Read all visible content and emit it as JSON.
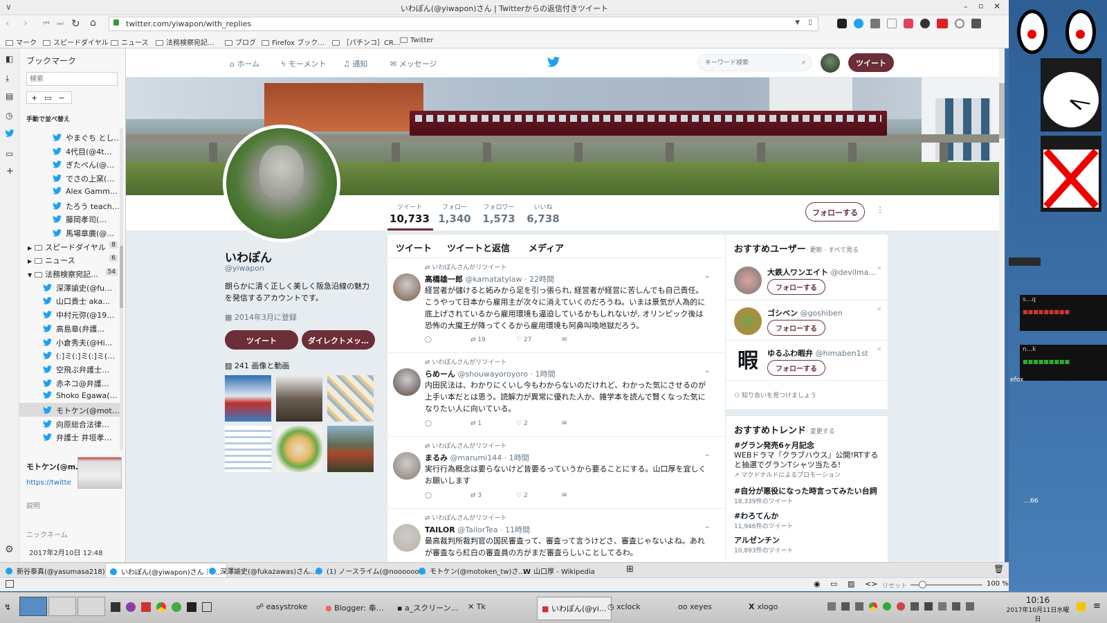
{
  "window": {
    "title": "いわぽん(@yiwapon)さん | Twitterからの返信付きツイート",
    "url": "twitter.com/yiwapon/with_replies"
  },
  "bookmarks_bar": [
    "マーク",
    "スピードダイヤル",
    "ニュース",
    "法務検察宛記…",
    "ブログ",
    "Firefox ブック…",
    "［パチンコ］CR…",
    "Twitter"
  ],
  "sidebar": {
    "title": "ブックマーク",
    "search_placeholder": "検索",
    "sort_label": "手動で並べ替え",
    "items": [
      {
        "type": "tw",
        "label": "やまぐち とし…"
      },
      {
        "type": "tw",
        "label": "4代目(@4t…"
      },
      {
        "type": "tw",
        "label": "ぎたぺん(@…"
      },
      {
        "type": "tw",
        "label": "でさの上窯(…"
      },
      {
        "type": "tw",
        "label": "Alex Gamm…"
      },
      {
        "type": "tw",
        "label": "たろう teach…"
      },
      {
        "type": "tw",
        "label": "藤岡孝司(…"
      },
      {
        "type": "tw",
        "label": "馬場章廣(@…"
      },
      {
        "type": "folder",
        "label": "スピードダイヤル",
        "count": "8"
      },
      {
        "type": "folder",
        "label": "ニュース",
        "count": "6"
      },
      {
        "type": "folderopen",
        "label": "法務検察宛記…",
        "count": "54"
      },
      {
        "type": "tw2",
        "label": "深澤諭史(@fu…"
      },
      {
        "type": "tw2",
        "label": "山口貴士 aka…"
      },
      {
        "type": "tw2",
        "label": "中村元弥(@19…"
      },
      {
        "type": "tw2",
        "label": "高島章(弁護…"
      },
      {
        "type": "tw2",
        "label": "小倉秀夫(@Hi…"
      },
      {
        "type": "tw2",
        "label": "(:]ミ(:]ミ(:]ミ(…"
      },
      {
        "type": "tw2",
        "label": "空飛ぶ弁護士…"
      },
      {
        "type": "tw2",
        "label": "赤ネコ@弁護…"
      },
      {
        "type": "tw2",
        "label": "Shoko Egawa(…"
      },
      {
        "type": "tw2",
        "label": "モトケン(@mot…",
        "selected": true
      },
      {
        "type": "tw2",
        "label": "向原総合法律…"
      },
      {
        "type": "tw2",
        "label": "弁護士 井垣孝…"
      }
    ],
    "detail": {
      "name": "モトケン(@m…",
      "url": "https://twitte",
      "desc_label": "説明",
      "nick_label": "ニックネーム",
      "date": "2017年2月10日 12:48"
    }
  },
  "twitter": {
    "nav": {
      "home": "ホーム",
      "moments": "モーメント",
      "notifications": "通知",
      "messages": "メッセージ",
      "search_placeholder": "キーワード検索",
      "tweet_btn": "ツイート"
    },
    "stats": [
      {
        "label": "ツイート",
        "value": "10,733"
      },
      {
        "label": "フォロー",
        "value": "1,340"
      },
      {
        "label": "フォロワー",
        "value": "1,573"
      },
      {
        "label": "いいね",
        "value": "6,738"
      }
    ],
    "follow_btn": "フォローする",
    "profile": {
      "name": "いわぽん",
      "handle": "@yiwapon",
      "bio": "朗らかに清く正しく美しく阪急沿線の魅力を発信するアカウントです。",
      "joined": "2014年3月に登録",
      "btn_tweet": "ツイート",
      "btn_dm": "ダイレクトメッ…",
      "media_label": "241 画像と動画"
    },
    "tabs": [
      "ツイート",
      "ツイートと返信",
      "メディア"
    ],
    "tweets": [
      {
        "rt": "いわぽんさんがリツイート",
        "name": "高橋雄一郎",
        "handle": "@kamatatylaw · 22時間",
        "text": "経営者が儲けると妬みから足を引っ張られ, 経営者が経営に苦しんでも自己責任。こうやって日本から雇用主が次々に消えていくのだろうね。いまは景気が人為的に底上げされているから雇用環境も逼迫しているかもしれないが, オリンピック後は恐怖の大魔王が降ってくるから雇用環境も阿鼻叫喚地獄だろう。",
        "reply": "",
        "rts": "19",
        "likes": "27"
      },
      {
        "rt": "いわぽんさんがリツイート",
        "name": "らめーん",
        "handle": "@shouwayoroyoro · 1時間",
        "text": "内田民法は、わかりにくいし今もわからないのだけれど、わかった気にさせるのが上手い本だとは思う。読解力が異常に優れた人か、雑学本を読んで賢くなった気になりたい人に向いている。",
        "reply": "",
        "rts": "1",
        "likes": "2"
      },
      {
        "rt": "いわぽんさんがリツイート",
        "name": "まるみ",
        "handle": "@marumi144 · 1時間",
        "text": "実行行為概念は要らないけど皆要るっていうから要ることにする。山口厚を宜しくお願いします",
        "reply": "",
        "rts": "3",
        "likes": "2"
      },
      {
        "rt": "いわぽんさんがリツイート",
        "name": "TAILOR",
        "handle": "@TailorTea · 11時間",
        "text": "最高裁判所裁判官の国民審査って、審査って言うけどさ、審査じゃないよね。あれが審査なら紅白の審査員の方がまだ審査らしいことしてるわ。",
        "reply": "",
        "rts": "",
        "likes": ""
      }
    ],
    "who_to_follow": {
      "title": "おすすめユーザー",
      "links": "· 更新 · すべて見る",
      "follow": "フォローする",
      "find": "知り合いを見つけましょう",
      "users": [
        {
          "name": "大鉄人ワンエイト",
          "handle": "@devilma…"
        },
        {
          "name": "ゴシベン",
          "handle": "@goshiben"
        },
        {
          "name": "ゆるふわ暇弁",
          "handle": "@himaben1st",
          "avatar_text": "暇"
        }
      ]
    },
    "trends": {
      "title": "おすすめトレンド",
      "change": "· 変更する",
      "items": [
        {
          "tag": "#グラン発売6ヶ月記念",
          "desc": "WEBドラマ『クラブハウス』公開!RTすると抽選でグランTシャツ当たる!",
          "meta": "マクドナルドによるプロモーション"
        },
        {
          "tag": "#自分が悪役になった時言ってみたい台詞",
          "meta": "18,339件のツイート"
        },
        {
          "tag": "#わろてんか",
          "meta": "11,946件のツイート"
        },
        {
          "tag": "アルゼンチン",
          "meta": "10,893件のツイート"
        }
      ]
    }
  },
  "tabs": [
    "新谷泰真(@yasumasa218)…",
    "いわぽん(@yiwapon)さん｜T…",
    "深澤諭史(@fukazawas)さん…",
    "(1) ノースライム(@noooooo…",
    "モトケン(@motoken_tw)さ…",
    "山口厚 - Wikipedia"
  ],
  "status": {
    "reset": "リセット",
    "zoom": "100 %"
  },
  "taskbar": {
    "items": [
      "easystroke",
      "Blogger: 奉…",
      "a_スクリーン…",
      "Tk",
      "いわぽん(@yi…",
      "xclock",
      "xeyes",
      "xlogo"
    ],
    "time": "10:16",
    "date": "2017年10月11日水曜日"
  },
  "desktop": {
    "term_text": "efox",
    "term_text2": "…66",
    "win1": "s...q",
    "win2": "n...k"
  }
}
